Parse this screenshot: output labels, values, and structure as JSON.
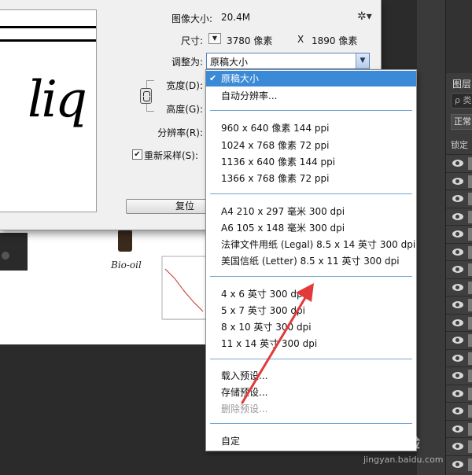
{
  "dialog": {
    "image_size_label": "图像大小:",
    "image_size_value": "20.4M",
    "dimensions_label": "尺寸:",
    "dimensions_toggle": "▼",
    "dimensions_width": "3780 像素",
    "dimensions_x": "X",
    "dimensions_height": "1890 像素",
    "fit_to_label": "调整为:",
    "fit_to_value": "原稿大小",
    "width_label": "宽度(D):",
    "height_label": "高度(G):",
    "resolution_label": "分辨率(R):",
    "resample_label": "重新采样(S):",
    "resample_checked": true,
    "reset_button": "复位",
    "preview_text": "liq"
  },
  "dropdown": {
    "items": [
      {
        "label": "原稿大小",
        "selected": true
      },
      {
        "label": "自动分辨率..."
      },
      {
        "label": "960 x 640 像素 144 ppi"
      },
      {
        "label": "1024 x 768 像素 72 ppi"
      },
      {
        "label": "1136 x 640 像素 144 ppi"
      },
      {
        "label": "1366 x 768 像素 72 ppi"
      },
      {
        "label": "A4 210 x 297 毫米 300 dpi"
      },
      {
        "label": "A6 105 x 148 毫米 300 dpi"
      },
      {
        "label": "法律文件用纸 (Legal) 8.5 x 14 英寸 300 dpi"
      },
      {
        "label": "美国信纸 (Letter) 8.5 x 11 英寸 300 dpi"
      },
      {
        "label": "4 x 6 英寸 300 dpi"
      },
      {
        "label": "5 x 7 英寸 300 dpi"
      },
      {
        "label": "8 x 10 英寸 300 dpi"
      },
      {
        "label": "11 x 14 英寸 300 dpi"
      },
      {
        "label": "载入预设..."
      },
      {
        "label": "存储预设..."
      },
      {
        "label": "删除预设...",
        "disabled": true
      },
      {
        "label": "自定"
      }
    ]
  },
  "document": {
    "bio_oil_label": "Bio-oil"
  },
  "layers_panel": {
    "title": "图层",
    "search_text": "ρ 类",
    "blend_mode": "正常",
    "lock_label": "锁定"
  },
  "watermark": {
    "brand": "经验",
    "url": "jingyan.baidu.com"
  },
  "colors": {
    "selection": "#3b8ad7",
    "separator": "#74a7d6",
    "annotation_arrow": "#e23a3a"
  }
}
